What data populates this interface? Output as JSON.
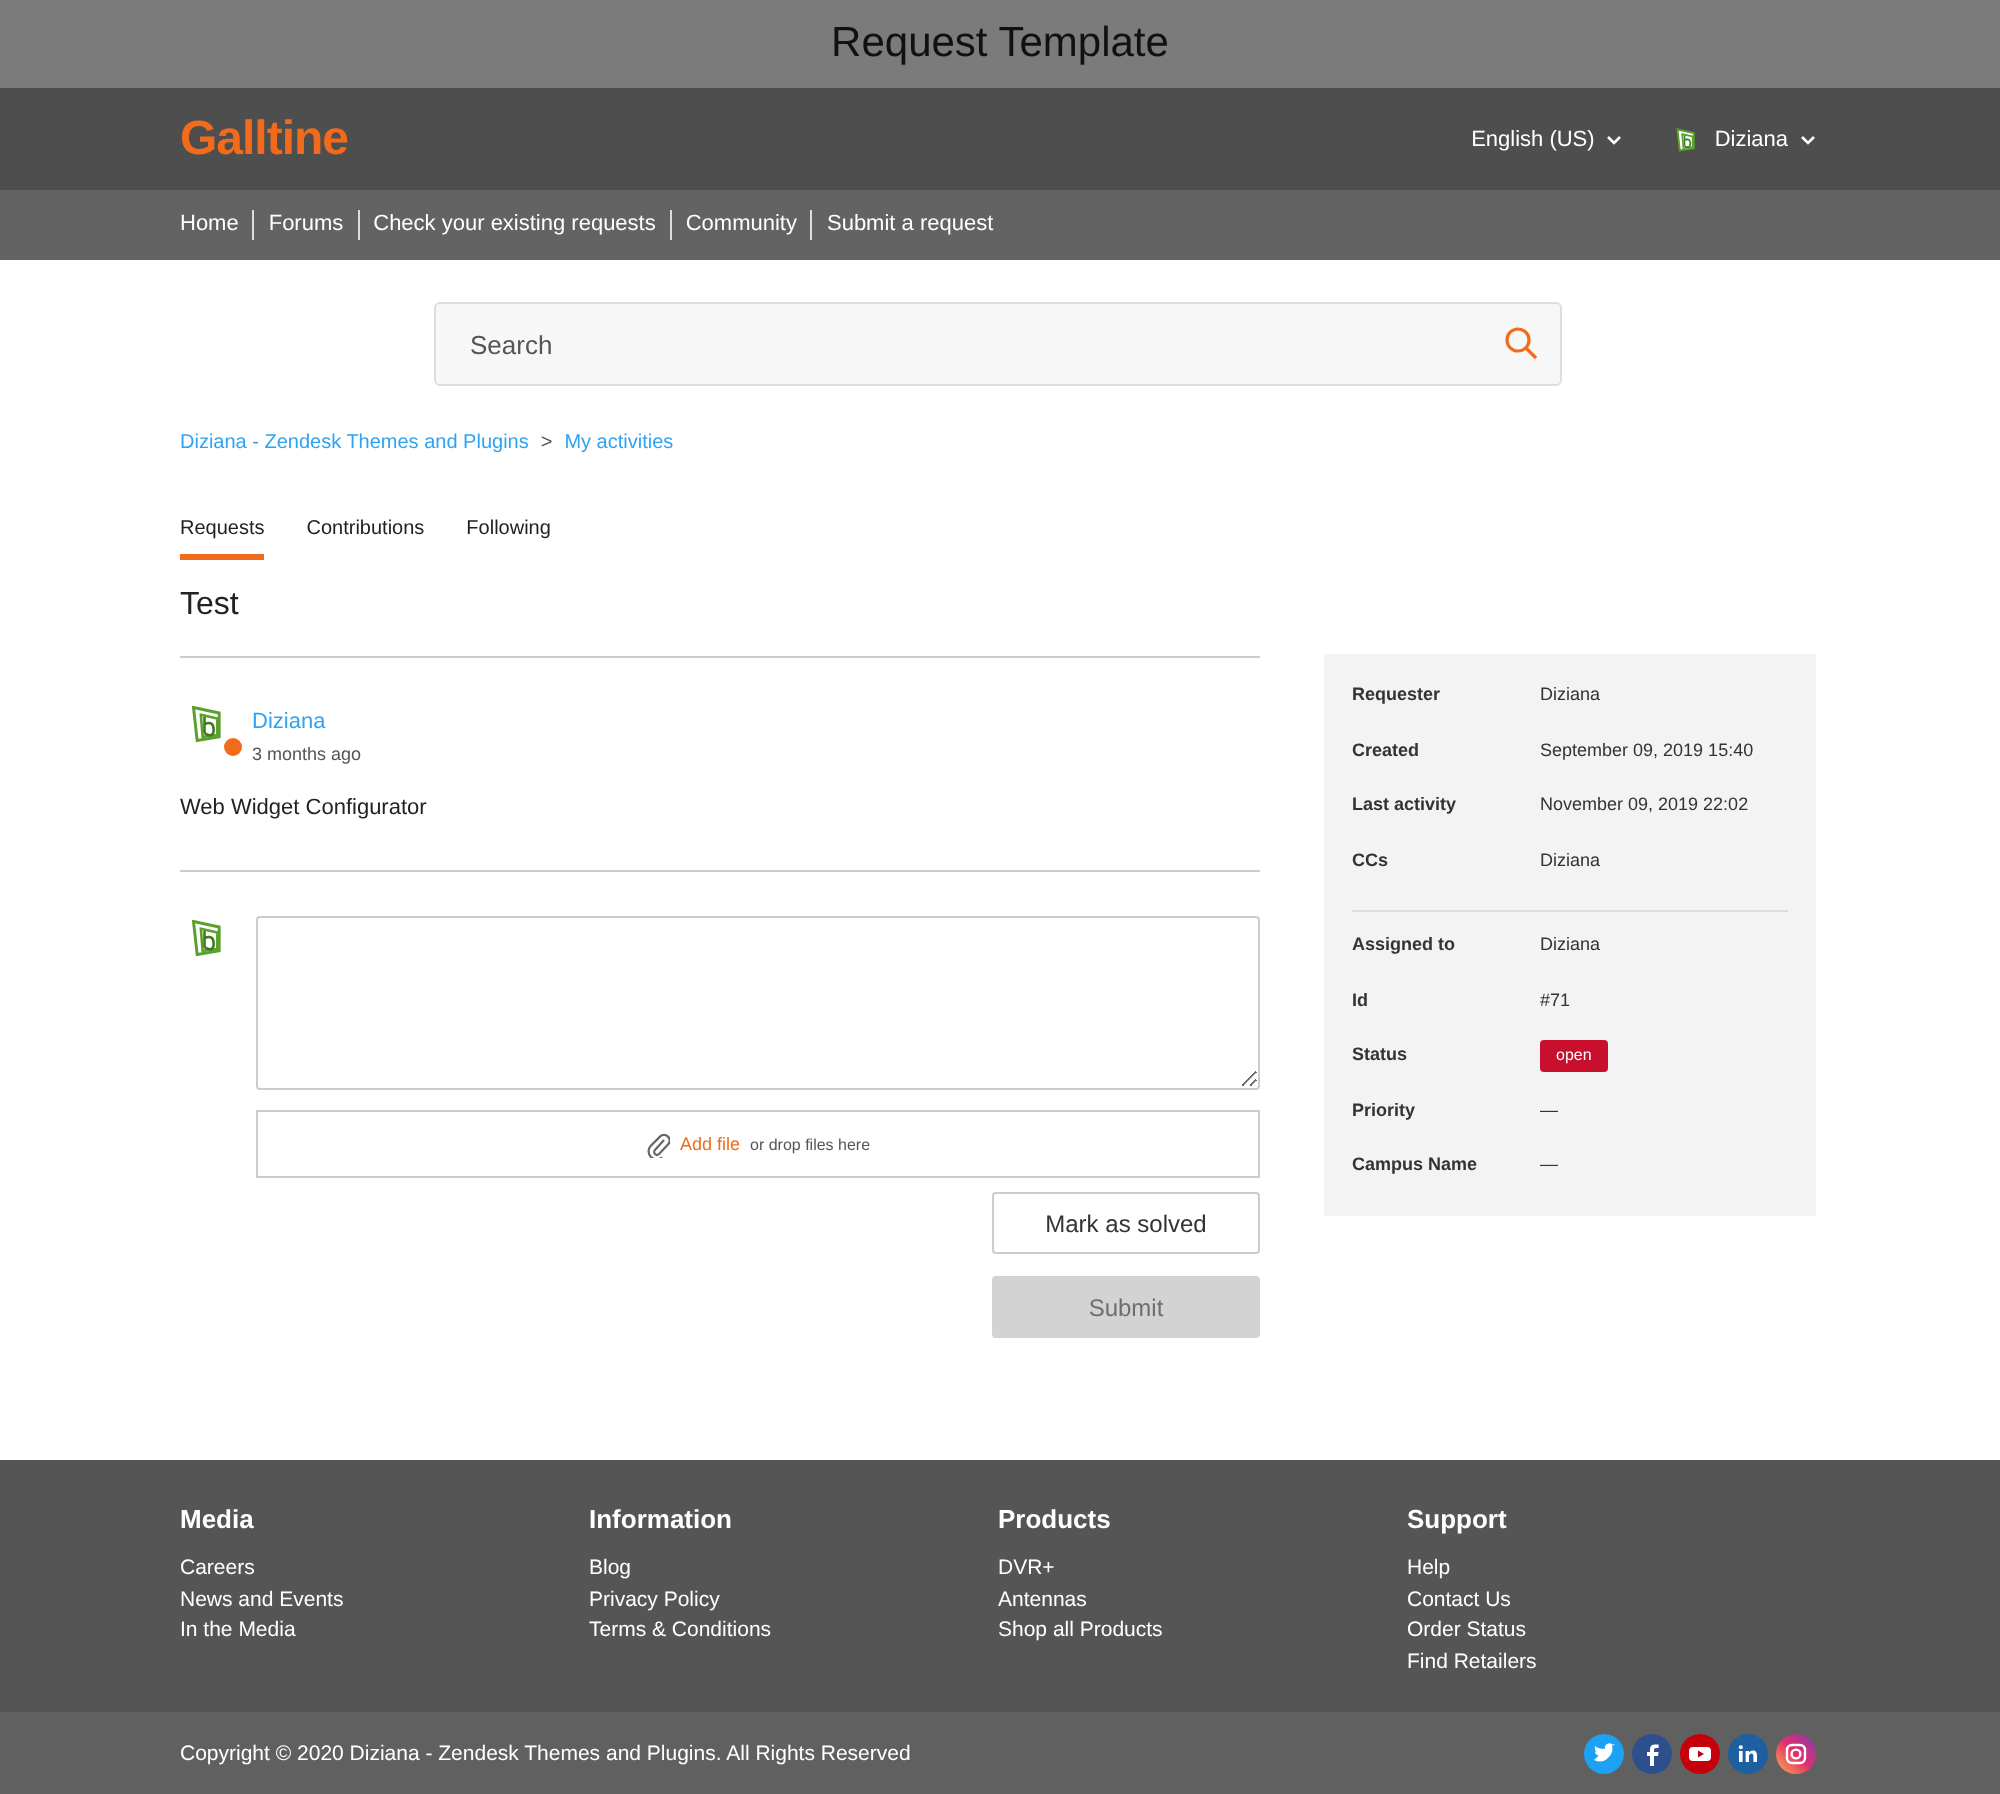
{
  "window": {
    "title": "Request Template"
  },
  "header": {
    "logo": "Galltine",
    "language": "English (US)",
    "user": "Diziana"
  },
  "nav": [
    "Home",
    "Forums",
    "Check your existing requests",
    "Community",
    "Submit a request"
  ],
  "search": {
    "placeholder": "Search"
  },
  "breadcrumbs": {
    "items": [
      "Diziana - Zendesk Themes and Plugins",
      "My activities"
    ],
    "separator": ">"
  },
  "tabs": [
    {
      "label": "Requests",
      "selected": true
    },
    {
      "label": "Contributions",
      "selected": false
    },
    {
      "label": "Following",
      "selected": false
    }
  ],
  "request": {
    "title": "Test",
    "comment": {
      "author": "Diziana",
      "time": "3 months ago",
      "body": "Web Widget Configurator"
    },
    "reply": {
      "attach_link": "Add file",
      "attach_text": "or drop files here"
    },
    "mark_solved": "Mark as solved",
    "submit": {
      "label": "Submit",
      "disabled": true
    }
  },
  "details": [
    [
      {
        "label": "Requester",
        "value": "Diziana",
        "kind": "text"
      },
      {
        "label": "Created",
        "value": "September 09, 2019 15:40",
        "kind": "text"
      },
      {
        "label": "Last activity",
        "value": "November 09, 2019 22:02",
        "kind": "text"
      },
      {
        "label": "CCs",
        "value": "Diziana",
        "kind": "text"
      }
    ],
    [
      {
        "label": "Assigned to",
        "value": "Diziana",
        "kind": "text"
      },
      {
        "label": "Id",
        "value": "#71",
        "kind": "text"
      },
      {
        "label": "Status",
        "value": "open",
        "kind": "badge"
      },
      {
        "label": "Priority",
        "value": "—",
        "kind": "text"
      },
      {
        "label": "Campus Name",
        "value": "—",
        "kind": "text"
      }
    ]
  ],
  "footer": {
    "columns": [
      {
        "heading": "Media",
        "links": [
          "Careers",
          "News and Events",
          "In the Media"
        ]
      },
      {
        "heading": "Information",
        "links": [
          "Blog",
          "Privacy Policy",
          "Terms & Conditions"
        ]
      },
      {
        "heading": "Products",
        "links": [
          "DVR+",
          "Antennas",
          "Shop all Products"
        ]
      },
      {
        "heading": "Support",
        "links": [
          "Help",
          "Contact Us",
          "Order Status",
          "Find Retailers"
        ]
      }
    ],
    "copyright": "Copyright © 2020 Diziana - Zendesk Themes and Plugins. All Rights Reserved"
  }
}
